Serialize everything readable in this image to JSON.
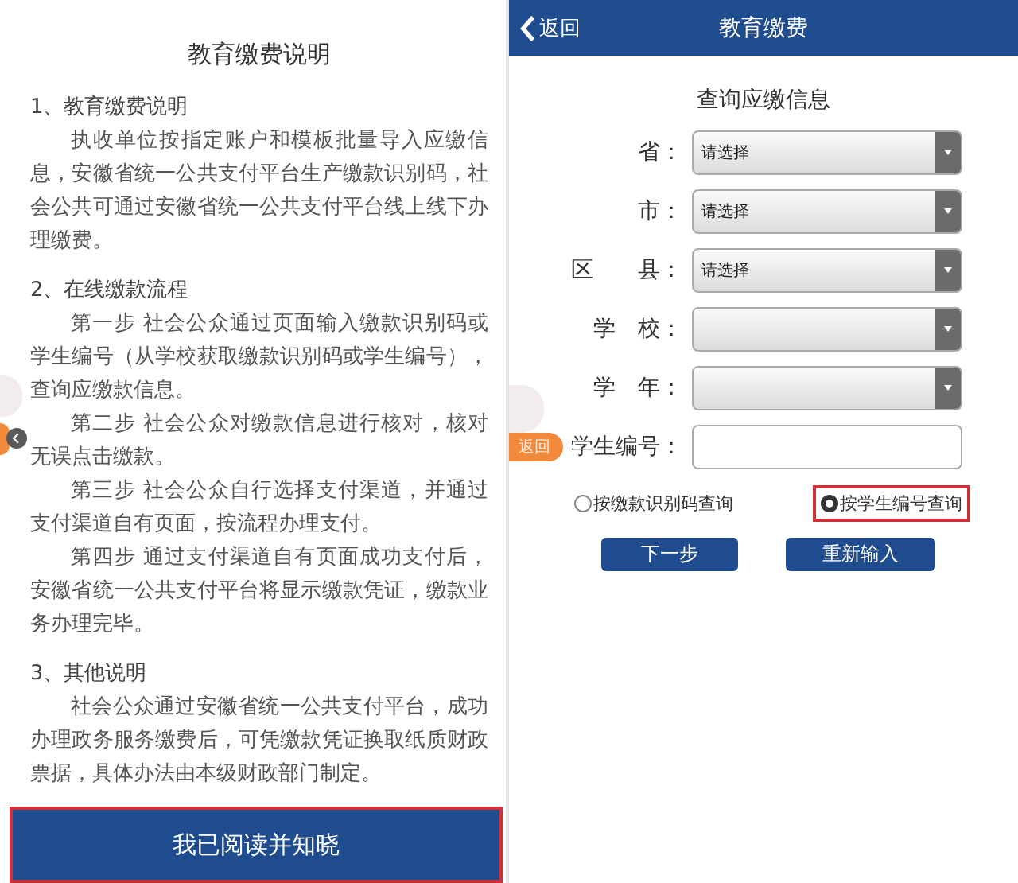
{
  "notice": {
    "title": "教育缴费说明",
    "sections": [
      {
        "heading": "1、教育缴费说明",
        "paragraphs": [
          "执收单位按指定账户和模板批量导入应缴信息，安徽省统一公共支付平台生产缴款识别码，社会公共可通过安徽省统一公共支付平台线上线下办理缴费。"
        ]
      },
      {
        "heading": "2、在线缴款流程",
        "paragraphs": [
          "第一步 社会公众通过页面输入缴款识别码或学生编号（从学校获取缴款识别码或学生编号），查询应缴款信息。",
          "第二步 社会公众对缴款信息进行核对，核对无误点击缴款。",
          "第三步 社会公众自行选择支付渠道，并通过支付渠道自有页面，按流程办理支付。",
          "第四步 通过支付渠道自有页面成功支付后，安徽省统一公共支付平台将显示缴款凭证，缴款业务办理完毕。"
        ]
      },
      {
        "heading": "3、其他说明",
        "paragraphs": [
          "社会公众通过安徽省统一公共支付平台，成功办理政务服务缴费后，可凭缴款凭证换取纸质财政票据，具体办法由本级财政部门制定。"
        ]
      }
    ],
    "confirm_button": "我已阅读并知晓"
  },
  "query": {
    "header": {
      "back": "返回",
      "title": "教育缴费"
    },
    "title": "查询应缴信息",
    "fields": [
      {
        "label": "省：",
        "kind": "select",
        "value": "请选择"
      },
      {
        "label": "市：",
        "kind": "select",
        "value": "请选择"
      },
      {
        "label": "区　　县：",
        "kind": "select",
        "value": "请选择"
      },
      {
        "label": "学　校：",
        "kind": "select"
      },
      {
        "label": "学　年：",
        "kind": "select"
      },
      {
        "label": "学生编号：",
        "kind": "text"
      }
    ],
    "modes": [
      {
        "label": "按缴款识别码查询",
        "selected": false
      },
      {
        "label": "按学生编号查询",
        "selected": true
      }
    ],
    "buttons": [
      "下一步",
      "重新输入"
    ],
    "floating_back": "返回"
  }
}
